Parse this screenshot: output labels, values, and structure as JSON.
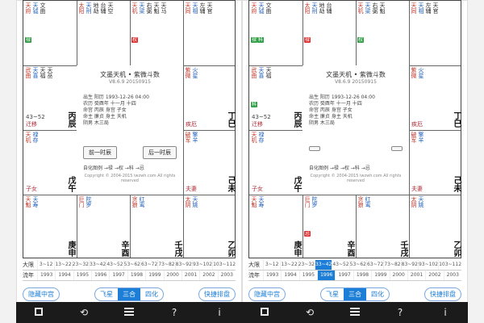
{
  "screens": [
    {
      "cells": [
        {
          "stars": [
            "天府",
            "天钺",
            "文曲"
          ],
          "tags": [
            {
              "t": "禄",
              "c": "green"
            }
          ],
          "range": "",
          "palace": "",
          "stem": ""
        },
        {
          "stars": [
            "太阳",
            "天刑",
            "地劫",
            "台辅",
            "天空"
          ],
          "tags": [],
          "range": "",
          "palace": "",
          "stem": ""
        },
        {
          "stars": [
            "天机",
            "天梁",
            "右弼",
            "天魁",
            "天马"
          ],
          "tags": [
            {
              "t": "权",
              "c": "red"
            }
          ],
          "range": "",
          "palace": "",
          "stem": ""
        },
        {
          "stars": [
            "天同",
            "天相",
            "左辅",
            "天官"
          ],
          "tags": [],
          "range": "",
          "palace": "",
          "stem": ""
        },
        {
          "stars": [
            "武曲",
            "天喜",
            "天福",
            "天巫"
          ],
          "tags": [],
          "range": "43~52",
          "palace": "迁移",
          "stem": "丙辰"
        },
        {
          "stars": [
            "紫微",
            "火星"
          ],
          "tags": [],
          "range": "",
          "palace": "疾厄",
          "stem": "丁巳"
        },
        {
          "stars": [
            "天机",
            "禄存"
          ],
          "tags": [],
          "range": "",
          "palace": "子女",
          "stem": "戊午"
        },
        {
          "stars": [
            "破军",
            "擎羊"
          ],
          "tags": [],
          "range": "",
          "palace": "夫妻",
          "stem": "己未"
        },
        {
          "stars": [
            "天魁",
            "天寿"
          ],
          "tags": [],
          "range": "",
          "palace": "",
          "stem": "庚申"
        },
        {
          "stars": [
            "巨门",
            "陀罗"
          ],
          "tags": [],
          "range": "",
          "palace": "",
          "stem": "辛酉"
        },
        {
          "stars": [
            "贪狼",
            "红鸾"
          ],
          "tags": [],
          "range": "",
          "palace": "",
          "stem": "壬戌"
        },
        {
          "stars": [
            "太阴",
            "天姚"
          ],
          "tags": [],
          "range": "",
          "palace": "",
          "stem": "乙卯"
        },
        {
          "stars": [
            "廉贞",
            "七杀",
            "天月",
            "天虚"
          ],
          "tags": [
            {
              "t": "忌",
              "c": "blue"
            }
          ],
          "range": "63~72",
          "palace": "",
          "stem": "甲寅"
        },
        {
          "stars": [
            "太阳",
            "天梁",
            "文昌"
          ],
          "tags": [],
          "range": "",
          "palace": "",
          "stem": "乙丑"
        },
        {
          "stars": [
            "七杀",
            "天德"
          ],
          "tags": [],
          "range": "",
          "palace": "",
          "stem": "甲子"
        },
        {
          "stars": [
            "天同",
            "天相",
            "天厨"
          ],
          "tags": [],
          "range": "",
          "palace": "",
          "stem": "癸亥"
        }
      ],
      "center": {
        "title": "文墨天机 • 紫微斗数",
        "version": "V8.6.9 20150915",
        "info": [
          "出生 阳历 1993-12-26 04:00",
          "农历 癸酉年 十一月 十四",
          "命宫 丙辰 身宫 子女",
          "命主 廉贞 身主 天机",
          "阴男 木三局"
        ],
        "prev": "前一时辰",
        "next": "后一时辰",
        "legend": "自化图例 →禄 →权 →科 →忌",
        "copyright": "Copyright © 2004-2015 iwzwh.com All rights reserved"
      },
      "table": {
        "row1_label": "大限",
        "row1": [
          "3~12",
          "13~22",
          "23~32",
          "33~42",
          "43~52",
          "53~62",
          "63~72",
          "73~82",
          "83~92",
          "93~102",
          "103~112"
        ],
        "row2_label": "流年",
        "row2": [
          "1993",
          "1994",
          "1995",
          "1996",
          "1997",
          "1998",
          "1999",
          "2000",
          "2001",
          "2002",
          "2003"
        ],
        "selected": -1
      },
      "toolbar": {
        "hide_center": "隐藏中宫",
        "fly": "飞星",
        "sanhe": "三合",
        "sihua": "四化",
        "quick": "快捷排盘"
      }
    },
    {
      "cells": [
        {
          "stars": [
            "天府",
            "天钺",
            "文曲"
          ],
          "tags": [
            {
              "t": "禄",
              "c": "green"
            },
            {
              "t": "科",
              "c": "green"
            }
          ],
          "range": "",
          "palace": "",
          "stem": ""
        },
        {
          "stars": [
            "太阳",
            "天刑",
            "地劫",
            "台辅"
          ],
          "tags": [
            {
              "t": "禄",
              "c": "red"
            }
          ],
          "range": "",
          "palace": "",
          "stem": ""
        },
        {
          "stars": [
            "天机",
            "天梁",
            "右弼",
            "天魁"
          ],
          "tags": [
            {
              "t": "权",
              "c": "green"
            }
          ],
          "range": "",
          "palace": "",
          "stem": ""
        },
        {
          "stars": [
            "天同",
            "天相",
            "左辅",
            "天官"
          ],
          "tags": [],
          "range": "",
          "palace": "",
          "stem": ""
        },
        {
          "stars": [
            "武曲",
            "天喜",
            "天福"
          ],
          "tags": [
            {
              "t": "科",
              "c": "green"
            }
          ],
          "range": "43~52",
          "palace": "迁移",
          "stem": "丙辰"
        },
        {
          "stars": [
            "紫微",
            "火星"
          ],
          "tags": [],
          "range": "",
          "palace": "疾厄",
          "stem": "丁巳"
        },
        {
          "stars": [
            "天机",
            "禄存"
          ],
          "tags": [],
          "range": "",
          "palace": "子女",
          "stem": "戊午"
        },
        {
          "stars": [
            "破军",
            "擎羊"
          ],
          "tags": [],
          "range": "",
          "palace": "夫妻",
          "stem": "己未"
        },
        {
          "stars": [
            "天魁",
            "天寿"
          ],
          "tags": [],
          "range": "",
          "palace": "",
          "stem": "庚申"
        },
        {
          "stars": [
            "巨门",
            "陀罗"
          ],
          "tags": [
            {
              "t": "忌",
              "c": "red"
            }
          ],
          "range": "",
          "palace": "",
          "stem": "辛酉"
        },
        {
          "stars": [
            "贪狼",
            "红鸾"
          ],
          "tags": [],
          "range": "",
          "palace": "",
          "stem": "壬戌"
        },
        {
          "stars": [
            "太阴",
            "天姚"
          ],
          "tags": [],
          "range": "",
          "palace": "",
          "stem": "乙卯"
        },
        {
          "stars": [
            "廉贞",
            "七杀",
            "天月"
          ],
          "tags": [
            {
              "t": "忌",
              "c": "green"
            }
          ],
          "range": "63~72",
          "palace": "",
          "stem": "甲寅"
        },
        {
          "stars": [
            "太阳",
            "天梁",
            "文昌"
          ],
          "tags": [],
          "range": "",
          "palace": "",
          "stem": "乙丑"
        },
        {
          "stars": [
            "七杀",
            "天德"
          ],
          "tags": [],
          "range": "",
          "palace": "",
          "stem": "甲子"
        },
        {
          "stars": [
            "天同",
            "天相",
            "天厨"
          ],
          "tags": [],
          "range": "",
          "palace": "",
          "stem": "癸亥"
        }
      ],
      "center": {
        "title": "文墨天机 • 紫微斗数",
        "version": "V8.6.9 20150915",
        "info": [
          "出生 阳历 1993-12-26 04:00",
          "农历 癸酉年 十一月 十四",
          "命宫 丙辰 身宫 子女",
          "命主 廉贞 身主 天机",
          "阴男 木三局"
        ],
        "prev": "",
        "next": "",
        "legend": "自化图例 →禄 →权 →科 →忌",
        "copyright": "Copyright © 2004-2015 iwzwh.com All rights reserved"
      },
      "table": {
        "row1_label": "大限",
        "row1": [
          "3~12",
          "13~22",
          "23~32",
          "33~42",
          "43~52",
          "53~62",
          "63~72",
          "73~82",
          "83~92",
          "93~102",
          "103~112"
        ],
        "row2_label": "流年",
        "row2": [
          "1993",
          "1994",
          "1995",
          "1996",
          "1997",
          "1998",
          "1999",
          "2000",
          "2001",
          "2002",
          "2003"
        ],
        "selected": 3
      },
      "toolbar": {
        "hide_center": "隐藏中宫",
        "fly": "飞星",
        "sanhe": "三合",
        "sihua": "四化",
        "quick": "快捷排盘"
      }
    }
  ],
  "colors": {
    "accent": "#1c7ed6",
    "red": "#e03131",
    "green": "#2f9e44"
  }
}
